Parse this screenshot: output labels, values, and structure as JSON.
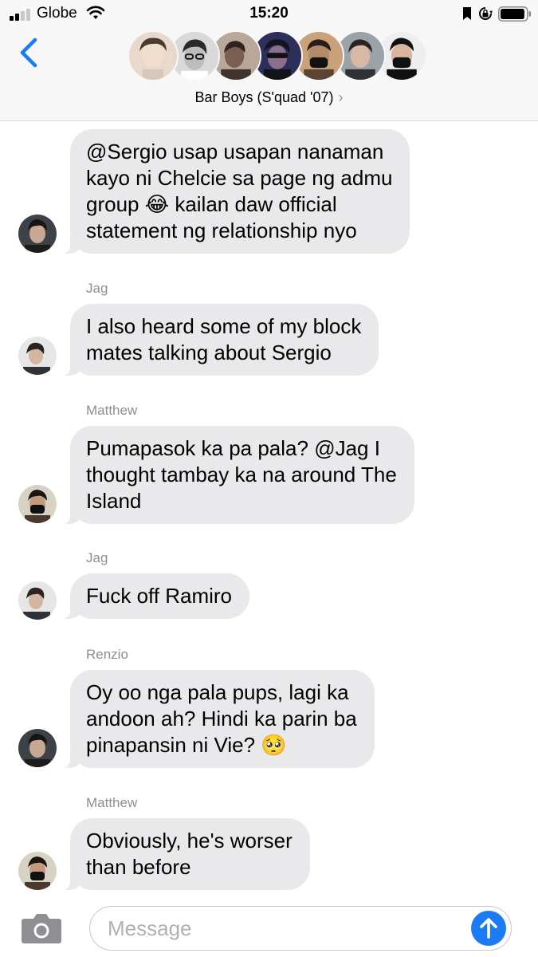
{
  "status_bar": {
    "carrier": "Globe",
    "time": "15:20",
    "signal_bars_active": 2,
    "signal_bars_total": 4,
    "battery_level": 0.95
  },
  "header": {
    "group_name": "Bar Boys (S'quad '07)",
    "chevron": "›",
    "back_icon": "chevron-left-icon",
    "member_count": 7
  },
  "messages": [
    {
      "sender": "",
      "text": "@Sergio usap usapan nanaman\nkayo ni Chelcie sa page ng admu\ngroup 😂 kailan daw official\nstatement ng relationship nyo"
    },
    {
      "sender": "Jag",
      "text": "I also heard some of my block\nmates talking about Sergio"
    },
    {
      "sender": "Matthew",
      "text": "Pumapasok ka pa pala? @Jag I\nthought tambay ka na around The\nIsland"
    },
    {
      "sender": "Jag",
      "text": "Fuck off Ramiro"
    },
    {
      "sender": "Renzio",
      "text": "Oy oo nga pala pups, lagi ka\nandoon ah? Hindi ka parin ba\npinapansin ni Vie? 🥺"
    },
    {
      "sender": "Matthew",
      "text": "Obviously, he's worser\nthan before"
    }
  ],
  "composer": {
    "placeholder": "Message",
    "camera_icon": "camera-icon",
    "send_icon": "send-arrow-icon"
  },
  "colors": {
    "accent": "#1a7cf5",
    "bubble": "#e9e9eb",
    "secondary_text": "#8e8e93"
  }
}
